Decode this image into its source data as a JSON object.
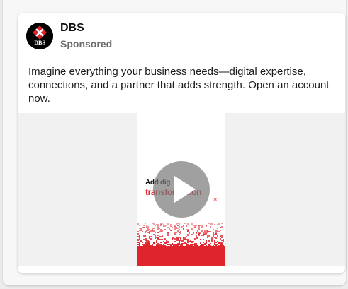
{
  "ad": {
    "advertiser": "DBS",
    "sponsored_label": "Sponsored",
    "avatar_text": "DBS",
    "body": "Imagine everything your business needs—digital expertise, connections, and a partner that adds strength. Open an account now.",
    "video": {
      "line1": "Add dig",
      "line2": "transformation",
      "close_glyph": "×"
    }
  },
  "colors": {
    "brand_red": "#e0242c",
    "text": "#1c1c1c",
    "secondary": "#6b6b6b"
  },
  "icons": {
    "play": "play-icon",
    "logo": "dbs-logo-icon"
  }
}
